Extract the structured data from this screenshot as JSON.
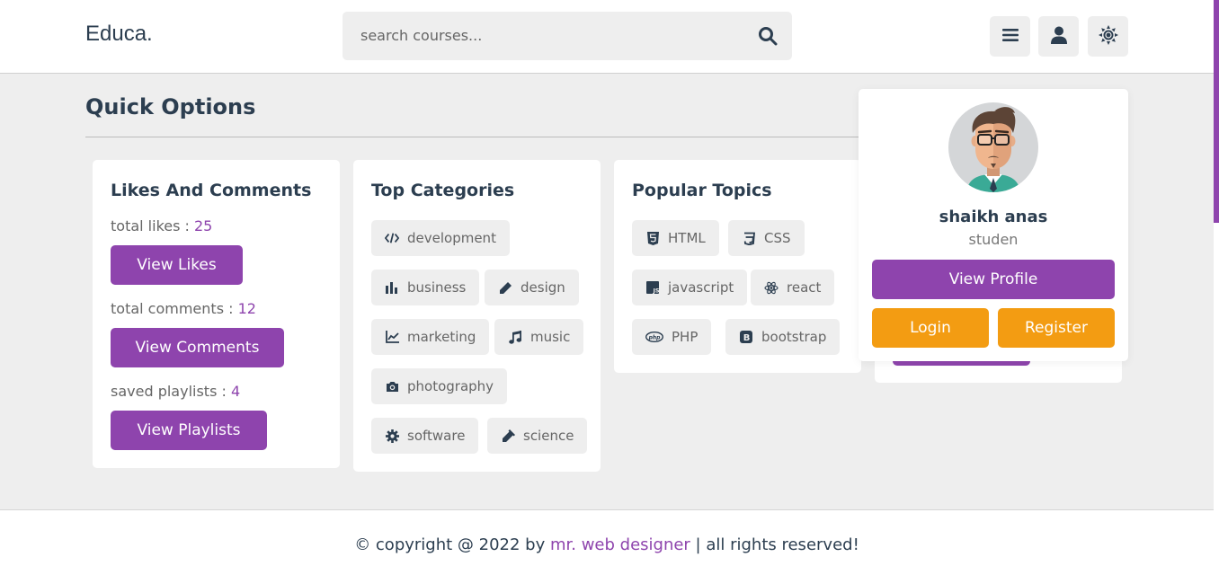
{
  "header": {
    "logo": "Educa.",
    "search_placeholder": "search courses..."
  },
  "page": {
    "heading": "Quick Options"
  },
  "likes_card": {
    "title": "Likes And Comments",
    "likes_label": "total likes : ",
    "likes_value": "25",
    "likes_button": "View Likes",
    "comments_label": "total comments : ",
    "comments_value": "12",
    "comments_button": "View Comments",
    "playlists_label": "saved playlists : ",
    "playlists_value": "4",
    "playlists_button": "View Playlists"
  },
  "categories_card": {
    "title": "Top Categories",
    "items": [
      {
        "label": "development",
        "icon": "code-icon"
      },
      {
        "label": "business",
        "icon": "chart-bar-icon"
      },
      {
        "label": "design",
        "icon": "pen-icon"
      },
      {
        "label": "marketing",
        "icon": "chart-line-icon"
      },
      {
        "label": "music",
        "icon": "music-icon"
      },
      {
        "label": "photography",
        "icon": "camera-icon"
      },
      {
        "label": "software",
        "icon": "cog-icon"
      },
      {
        "label": "science",
        "icon": "vial-icon"
      }
    ]
  },
  "topics_card": {
    "title": "Popular Topics",
    "items": [
      {
        "label": "HTML",
        "icon": "html5-icon"
      },
      {
        "label": "CSS",
        "icon": "css3-icon"
      },
      {
        "label": "javascript",
        "icon": "js-icon"
      },
      {
        "label": "react",
        "icon": "react-icon"
      },
      {
        "label": "PHP",
        "icon": "php-icon"
      },
      {
        "label": "bootstrap",
        "icon": "bootstrap-icon"
      }
    ]
  },
  "profile": {
    "name": "shaikh anas",
    "role": "studen",
    "view_profile": "View Profile",
    "login": "Login",
    "register": "Register"
  },
  "footer": {
    "prefix": "© copyright @ 2022 by ",
    "link": "mr. web designer",
    "suffix": " | all rights reserved!"
  },
  "colors": {
    "accent": "#8e44ad",
    "orange": "#f39c12",
    "text": "#2c3e50",
    "background": "#eeeeee"
  }
}
